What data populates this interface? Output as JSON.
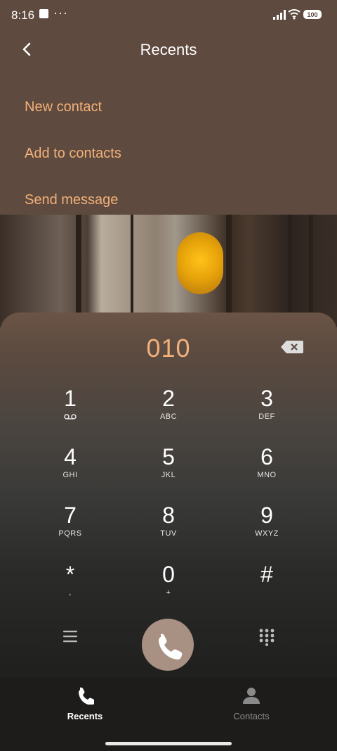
{
  "status": {
    "time": "8:16",
    "dots": "···",
    "battery": "100"
  },
  "header": {
    "title": "Recents",
    "back_icon": "chevron-left-icon"
  },
  "menu": [
    {
      "label": "New contact"
    },
    {
      "label": "Add to contacts"
    },
    {
      "label": "Send message"
    }
  ],
  "dialer": {
    "number": "010",
    "keys": [
      {
        "digit": "1",
        "letters": "∞"
      },
      {
        "digit": "2",
        "letters": "ABC"
      },
      {
        "digit": "3",
        "letters": "DEF"
      },
      {
        "digit": "4",
        "letters": "GHI"
      },
      {
        "digit": "5",
        "letters": "JKL"
      },
      {
        "digit": "6",
        "letters": "MNO"
      },
      {
        "digit": "7",
        "letters": "PQRS"
      },
      {
        "digit": "8",
        "letters": "TUV"
      },
      {
        "digit": "9",
        "letters": "WXYZ"
      },
      {
        "digit": "*",
        "letters": ","
      },
      {
        "digit": "0",
        "letters": "+"
      },
      {
        "digit": "#",
        "letters": ""
      }
    ]
  },
  "bottom_nav": [
    {
      "label": "Recents",
      "icon": "phone-icon",
      "active": true
    },
    {
      "label": "Contacts",
      "icon": "person-icon",
      "active": false
    }
  ],
  "colors": {
    "accent": "#f2b07a",
    "call_button": "#a89182"
  }
}
